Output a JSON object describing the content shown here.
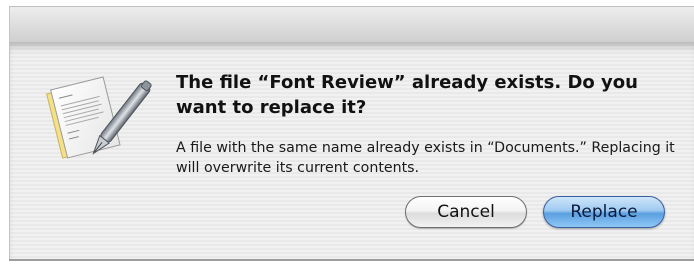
{
  "dialog": {
    "title": "The file “Font Review” already exists. Do you want to replace it?",
    "message": "A file with the same name already exists in “Documents.” Replacing it will overwrite its current contents.",
    "icon": "textedit-document-icon"
  },
  "buttons": {
    "cancel_label": "Cancel",
    "replace_label": "Replace"
  },
  "colors": {
    "default_button": "#5a9fe0",
    "sheet_background": "#eeeeee"
  }
}
